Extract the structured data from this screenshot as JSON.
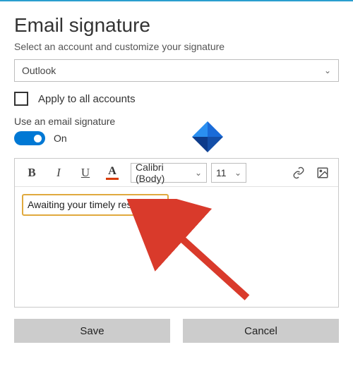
{
  "title": "Email signature",
  "subtitle": "Select an account and customize your signature",
  "accountSelect": {
    "value": "Outlook"
  },
  "applyAll": {
    "label": "Apply to all accounts",
    "checked": false
  },
  "useSignature": {
    "label": "Use an email signature",
    "toggleState": "On"
  },
  "toolbar": {
    "fontName": "Calibri (Body)",
    "fontSize": "11"
  },
  "editor": {
    "content": "Awaiting your timely response!"
  },
  "buttons": {
    "save": "Save",
    "cancel": "Cancel"
  },
  "colors": {
    "accent": "#0078d4",
    "highlight": "#e0a93e",
    "fontUnderline": "#d83b01"
  }
}
